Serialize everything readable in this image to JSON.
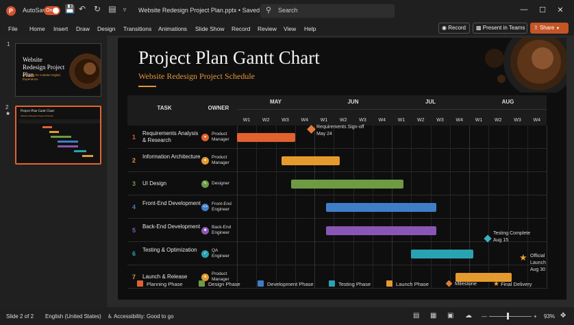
{
  "titlebar": {
    "autosave_label": "AutoSave",
    "autosave_state": "On",
    "doc_title": "Website Redesign Project Plan.pptx • Saved ∨",
    "search_placeholder": "Search",
    "app_letter": "P"
  },
  "ribbon": {
    "tabs": [
      "File",
      "Home",
      "Insert",
      "Draw",
      "Design",
      "Transitions",
      "Animations",
      "Slide Show",
      "Record",
      "Review",
      "View",
      "Help"
    ],
    "record_label": "Record",
    "present_label": "Present in Teams",
    "share_label": "Share"
  },
  "thumbnails": [
    {
      "number": "1",
      "title": "Website Redesign Project Plan",
      "subtitle": "Planning for a Better Digital Experience"
    },
    {
      "number": "2",
      "title": "Project Plan Gantt Chart",
      "subtitle": "Website Redesign Project Schedule"
    }
  ],
  "slide": {
    "title": "Project Plan Gantt Chart",
    "subtitle": "Website Redesign Project Schedule",
    "headers": {
      "task": "TASK",
      "owner": "OWNER"
    },
    "months": [
      "MAY",
      "JUN",
      "JUL",
      "AUG"
    ],
    "weeks": [
      "W1",
      "W2",
      "W3",
      "W4",
      "W1",
      "W2",
      "W3",
      "W4",
      "W1",
      "W2",
      "W3",
      "W4",
      "W1",
      "W2",
      "W3",
      "W4"
    ],
    "rows": [
      {
        "num": "1",
        "task": "Requirements Analysis & Research",
        "owner": "Product Manager",
        "color": "#e0622f"
      },
      {
        "num": "2",
        "task": "Information Architecture",
        "owner": "Product Manager",
        "color": "#e59a2e"
      },
      {
        "num": "3",
        "task": "UI Design",
        "owner": "Designer",
        "color": "#6e9a44"
      },
      {
        "num": "4",
        "task": "Front-End Development",
        "owner": "Front-End Engineer",
        "color": "#3f7ec7"
      },
      {
        "num": "5",
        "task": "Back-End Development",
        "owner": "Back-End Engineer",
        "color": "#8a56b5"
      },
      {
        "num": "6",
        "task": "Testing & Optimization",
        "owner": "QA Engineer",
        "color": "#2aa3b0"
      },
      {
        "num": "7",
        "task": "Launch & Release",
        "owner": "Product Manager",
        "color": "#e59a2e"
      }
    ],
    "milestones": [
      {
        "label": "Requirements Sign-off",
        "date": "May 24"
      },
      {
        "label": "Testing Complete",
        "date": "Aug 15"
      },
      {
        "label": "Official Launch",
        "date": "Aug 30"
      }
    ],
    "legend": [
      {
        "label": "Planning Phase",
        "color": "#e0622f"
      },
      {
        "label": "Design Phase",
        "color": "#6e9a44"
      },
      {
        "label": "Development Phase",
        "color": "#3f7ec7"
      },
      {
        "label": "Testing Phase",
        "color": "#2aa3b0"
      },
      {
        "label": "Launch Phase",
        "color": "#e59a2e"
      },
      {
        "label": "Milestone",
        "color": "#e07a3a"
      },
      {
        "label": "Final Delivery",
        "color": "#f0a030"
      }
    ]
  },
  "chart_data": {
    "type": "table",
    "title": "Project Plan Gantt Chart",
    "subtitle": "Website Redesign Project Schedule",
    "categories": [
      "Requirements Analysis & Research",
      "Information Architecture",
      "UI Design",
      "Front-End Development",
      "Back-End Development",
      "Testing & Optimization",
      "Launch & Release"
    ],
    "series": [
      {
        "name": "start_week",
        "values": [
          1,
          3.3,
          3.8,
          5.6,
          5.6,
          10,
          12.3
        ]
      },
      {
        "name": "end_week",
        "values": [
          4,
          6.3,
          9.6,
          11.3,
          11.3,
          13.2,
          15.2
        ]
      }
    ],
    "xlabel": "",
    "ylabel": ""
  },
  "statusbar": {
    "slide_counter": "Slide 2 of 2",
    "language": "English (United States)",
    "accessibility": "Accessibility: Good to go",
    "zoom": "93%"
  }
}
